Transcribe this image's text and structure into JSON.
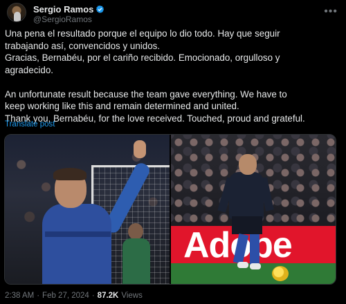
{
  "author": {
    "display_name": "Sergio Ramos",
    "handle": "@SergioRamos",
    "verified": true
  },
  "tweet": {
    "lines_es": [
      "Una pena el resultado porque el equipo lo dio todo. Hay que seguir",
      "trabajando así, convencidos y unidos.",
      "Gracias, Bernabéu, por el cariño recibido. Emocionado, orgulloso y",
      "agradecido."
    ],
    "lines_en": [
      "An unfortunate result because the team gave everything. We have to",
      "keep working like this and remain determined and united.",
      "Thank you, Bernabéu, for the love received. Touched, proud and grateful."
    ],
    "translate_label": "Translate post"
  },
  "media": {
    "right_board_text": "Adobe"
  },
  "meta": {
    "time": "2:38 AM",
    "separator": "·",
    "date": "Feb 27, 2024",
    "views_count": "87.2K",
    "views_label": "Views"
  },
  "colors": {
    "background": "#000000",
    "text": "#e7e9ea",
    "secondary": "#71767b",
    "link": "#1d9bf0",
    "verified": "#1d9bf0"
  },
  "icons": {
    "verified": "verified-badge-icon",
    "more": "more-options-icon"
  }
}
